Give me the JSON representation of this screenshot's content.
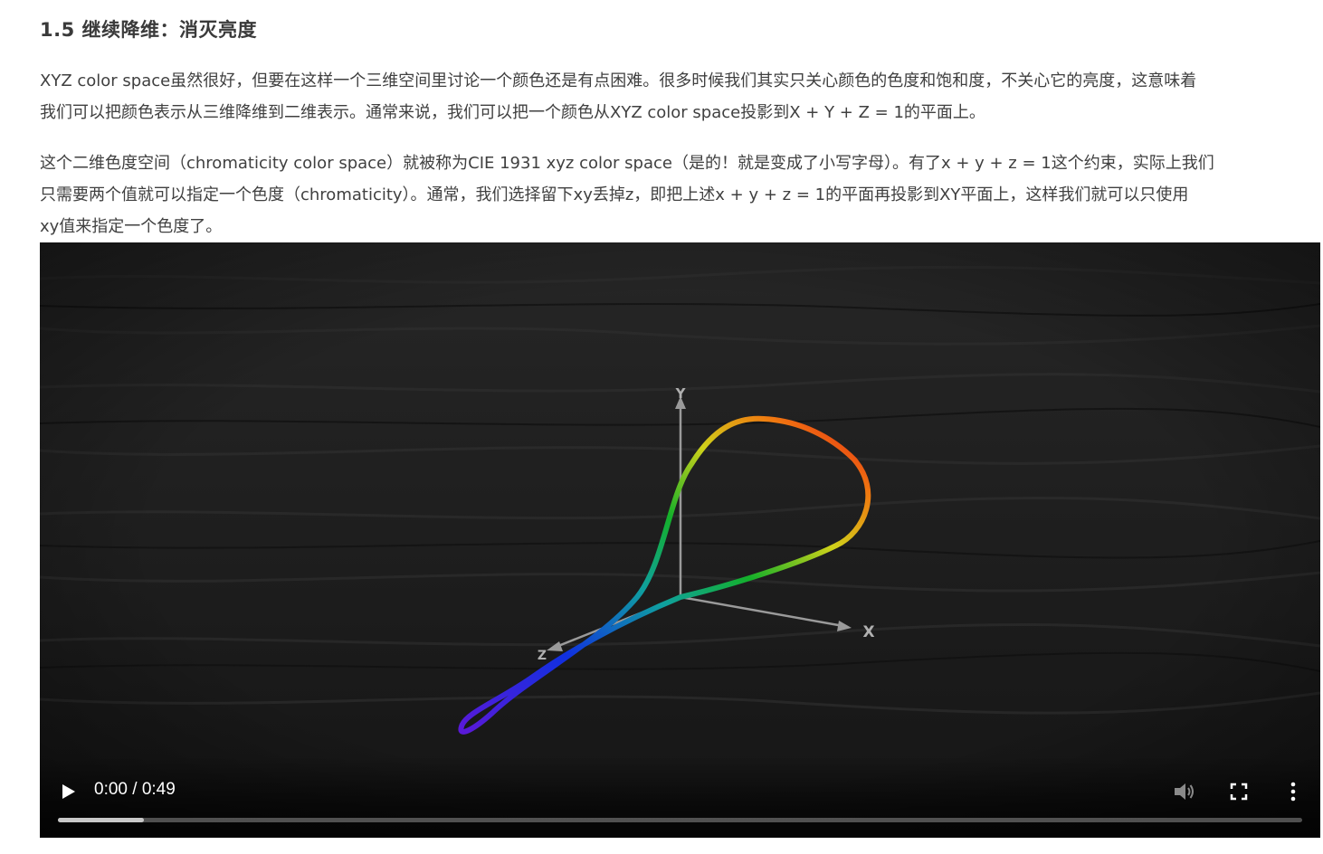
{
  "article": {
    "heading": "1.5 继续降维：消灭亮度",
    "paragraph1": [
      "XYZ color space虽然很好，但要在这样一个三维空间里讨论一个颜色还是有点困难。很多时候我们其实只关心颜色的色度和饱和度，不关心它的亮度，这意味着",
      "我们可以把颜色表示从三维降维到二维表示。通常来说，我们可以把一个颜色从XYZ color space投影到X + Y + Z = 1的平面上。"
    ],
    "paragraph2": [
      "这个二维色度空间（chromaticity color space）就被称为CIE 1931 xyz color space（是的！就是变成了小写字母）。有了x + y + z = 1这个约束，实际上我们",
      "只需要两个值就可以指定一个色度（chromaticity）。通常，我们选择留下xy丢掉z，即把上述x + y + z = 1的平面再投影到XY平面上，这样我们就可以只使用",
      "xy值来指定一个色度了。"
    ]
  },
  "video": {
    "axis_labels": {
      "y": "Y",
      "x": "X",
      "z": "Z"
    },
    "controls": {
      "time_display": "0:00 / 0:49",
      "progress_fraction": 0.069,
      "play_icon": "play-icon",
      "mute_icon": "volume-icon",
      "fullscreen_icon": "fullscreen-icon",
      "more_icon": "more-vertical-icon"
    },
    "colors": {
      "background": "#1c1c1c",
      "axis": "#9a9a9a",
      "progress_fill": "#c8c8c8"
    }
  }
}
